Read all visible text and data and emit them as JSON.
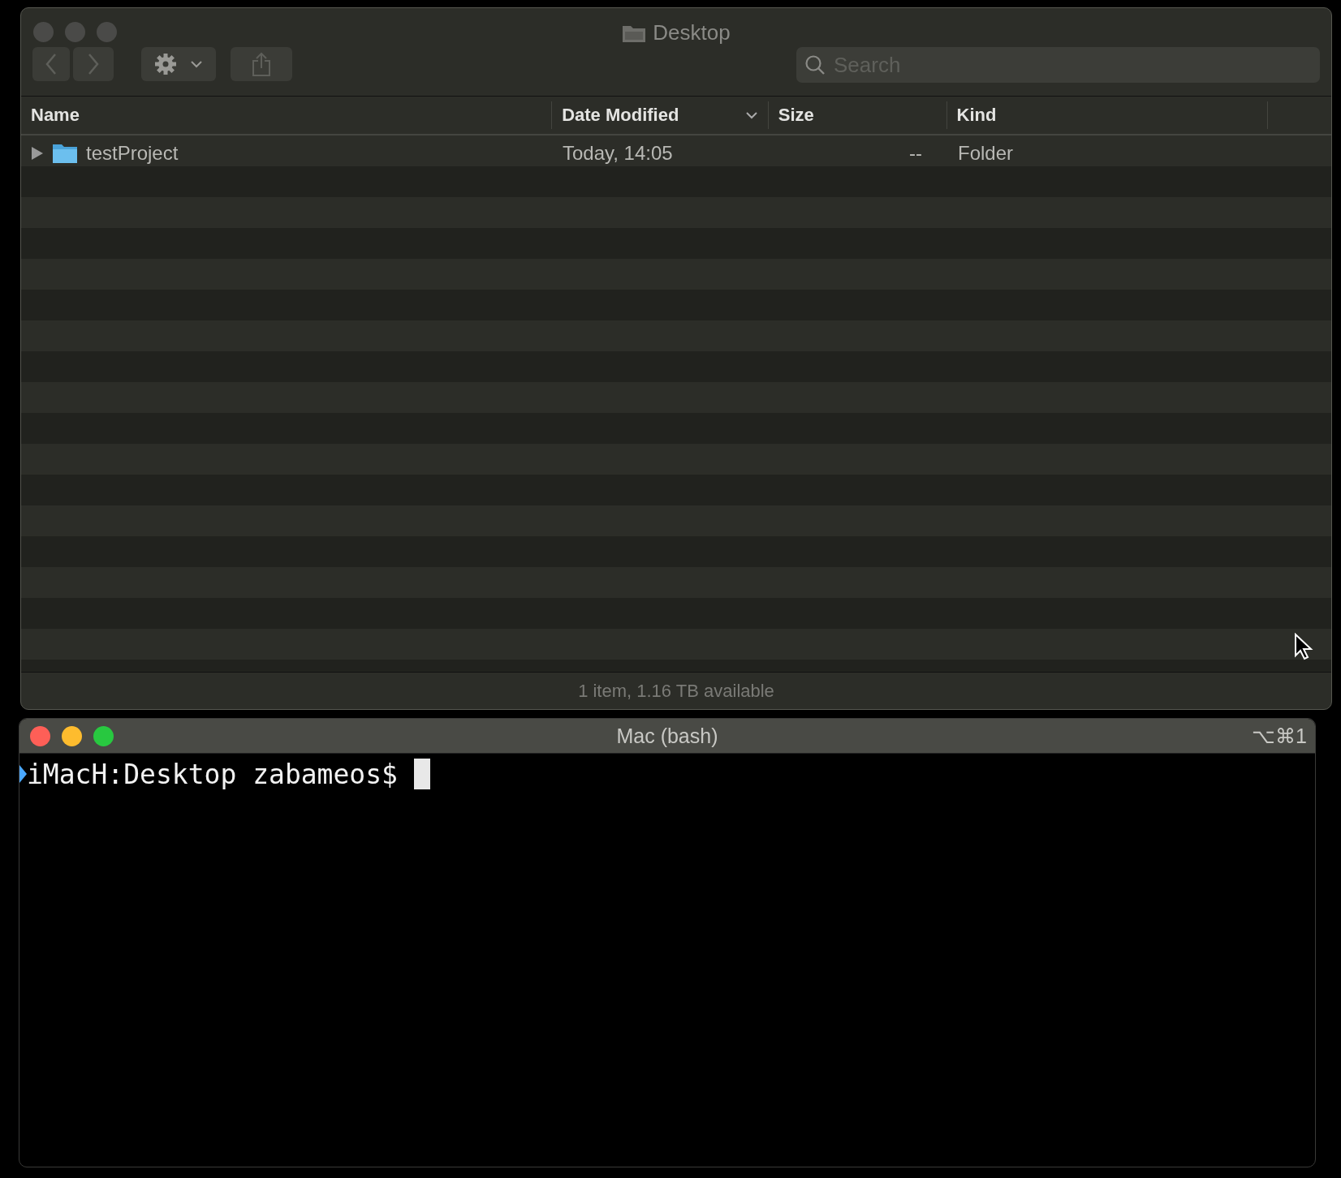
{
  "finder": {
    "title": "Desktop",
    "active": false,
    "search": {
      "placeholder": "Search"
    },
    "columns": [
      {
        "label": "Name",
        "sorted": false
      },
      {
        "label": "Date Modified",
        "sorted": true
      },
      {
        "label": "Size",
        "sorted": false
      },
      {
        "label": "Kind",
        "sorted": false
      }
    ],
    "rows": [
      {
        "name": "testProject",
        "date": "Today, 14:05",
        "size": "--",
        "kind": "Folder",
        "expanded": false
      }
    ],
    "status_bar": "1 item, 1.16 TB available"
  },
  "terminal": {
    "title": "Mac (bash)",
    "active": true,
    "shortcut": "⌥⌘1",
    "prompt": "iMacH:Desktop zabameos$"
  }
}
